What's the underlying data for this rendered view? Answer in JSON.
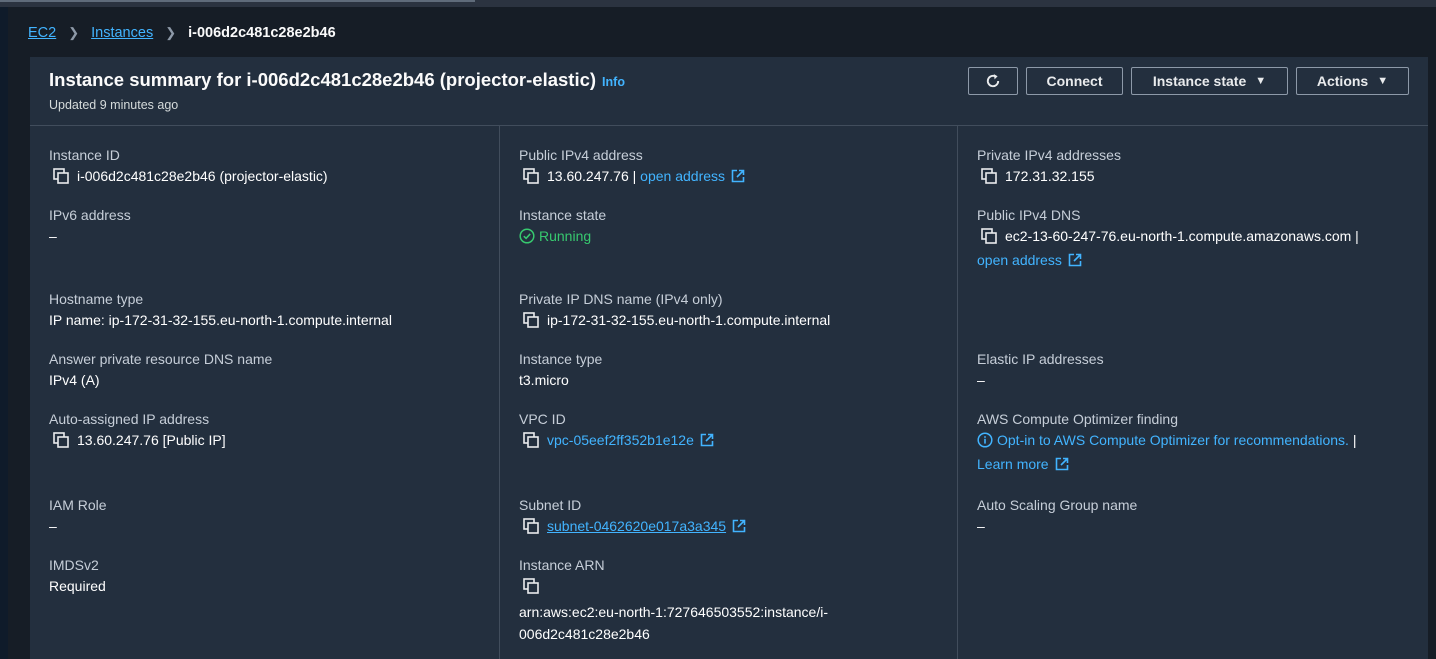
{
  "breadcrumb": {
    "ec2": "EC2",
    "instances": "Instances",
    "current": "i-006d2c481c28e2b46"
  },
  "header": {
    "title": "Instance summary for i-006d2c481c28e2b46 (projector-elastic)",
    "info": "Info",
    "updated": "Updated 9 minutes ago",
    "buttons": {
      "connect": "Connect",
      "instance_state": "Instance state",
      "actions": "Actions"
    }
  },
  "fields": {
    "instance_id": {
      "label": "Instance ID",
      "value": "i-006d2c481c28e2b46 (projector-elastic)"
    },
    "ipv6": {
      "label": "IPv6 address",
      "value": "–"
    },
    "hostname_type": {
      "label": "Hostname type",
      "value": "IP name: ip-172-31-32-155.eu-north-1.compute.internal"
    },
    "answer_dns": {
      "label": "Answer private resource DNS name",
      "value": "IPv4 (A)"
    },
    "auto_ip": {
      "label": "Auto-assigned IP address",
      "value": "13.60.247.76 [Public IP]"
    },
    "iam_role": {
      "label": "IAM Role",
      "value": "–"
    },
    "imdsv2": {
      "label": "IMDSv2",
      "value": "Required"
    },
    "public_ipv4": {
      "label": "Public IPv4 address",
      "value": "13.60.247.76",
      "separator": " | ",
      "link": "open address"
    },
    "instance_state": {
      "label": "Instance state",
      "value": "Running"
    },
    "private_dns_name": {
      "label": "Private IP DNS name (IPv4 only)",
      "value": "ip-172-31-32-155.eu-north-1.compute.internal"
    },
    "instance_type": {
      "label": "Instance type",
      "value": "t3.micro"
    },
    "vpc_id": {
      "label": "VPC ID",
      "value": "vpc-05eef2ff352b1e12e"
    },
    "subnet_id": {
      "label": "Subnet ID",
      "value": "subnet-0462620e017a3a345"
    },
    "instance_arn": {
      "label": "Instance ARN",
      "value_line1": "arn:aws:ec2:eu-north-1:727646503552:instance/i-",
      "value_line2": "006d2c481c28e2b46"
    },
    "private_ipv4": {
      "label": "Private IPv4 addresses",
      "value": "172.31.32.155"
    },
    "public_dns": {
      "label": "Public IPv4 DNS",
      "value": "ec2-13-60-247-76.eu-north-1.compute.amazonaws.com",
      "separator": " |",
      "link": "open address"
    },
    "elastic_ip": {
      "label": "Elastic IP addresses",
      "value": "–"
    },
    "optimizer": {
      "label": "AWS Compute Optimizer finding",
      "link": "Opt-in to AWS Compute Optimizer for recommendations.",
      "separator": " |",
      "learn_more": "Learn more"
    },
    "asg_name": {
      "label": "Auto Scaling Group name",
      "value": "–"
    }
  },
  "colors": {
    "background": "#161d26",
    "card": "#232f3e",
    "link": "#42b4ff",
    "running": "#37c96f"
  },
  "icons": [
    "refresh-icon",
    "caret-down-icon",
    "copy-icon",
    "external-link-icon",
    "check-circle-icon",
    "info-icon",
    "chevron-right-icon"
  ]
}
